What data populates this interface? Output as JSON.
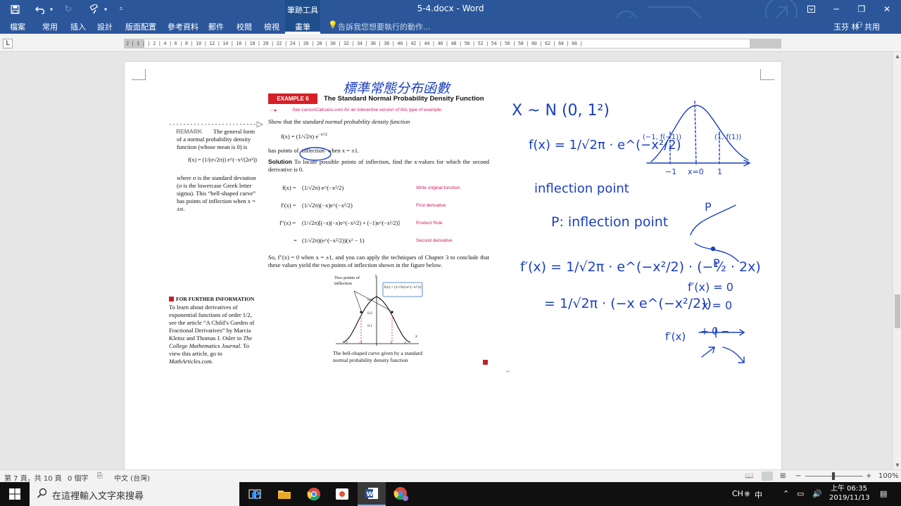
{
  "window": {
    "title": "5-4.docx - Word",
    "contextual_group": "筆跡工具",
    "minimize": "─",
    "restore": "❐",
    "close": "✕"
  },
  "ribbon": {
    "tabs": [
      "檔案",
      "常用",
      "插入",
      "設計",
      "版面配置",
      "參考資料",
      "郵件",
      "校閱",
      "檢視"
    ],
    "active_tab": "畫筆",
    "tell_me": "告訴我您想要執行的動作...",
    "user": "玉芬 林",
    "share": "共用"
  },
  "ruler": {
    "selector": "L",
    "ticks": "2 | 1 | | 2 | 4 | 6 | 8 | 10 | 12 | 14 | 16 | 18 | 20 | 22 | 24 | 26 | 28 | 30 | 32 | 34 | 36 | 38 | 40 | 42 | 44 | 46 | 48 | 50 | 52 | 54 | 56 | 58 | 60 | 62 | 64 | 66 |"
  },
  "textbook": {
    "example_badge": "EXAMPLE 6",
    "example_title": "The Standard Normal Probability Density Function",
    "example_link": "See LarsonCalculus.com for an interactive version of this type of example.",
    "show_that_1": "Show that the",
    "show_that_2": "standard normal probability density function",
    "fx_eq": "f(x) = (1/√2π) e",
    "fx_exp": "−x²/2",
    "has_points": "has points of",
    "inflection_word": "inflection",
    "when_x": "when x = ±1.",
    "solution_label": "Solution",
    "solution_text": "To locate possible points of inflection, find the x-values for which the second derivative is 0.",
    "deriv_lines": [
      {
        "lhs": "f(x) =",
        "rhs": "(1/√2π) e^(−x²/2)",
        "note": "Write original function."
      },
      {
        "lhs": "f′(x) =",
        "rhs": "(1/√2π)(−x)e^(−x²/2)",
        "note": "First derivative"
      },
      {
        "lhs": "f″(x) =",
        "rhs": "(1/√2π)[(−x)(−x)e^(−x²/2) + (−1)e^(−x²/2)]",
        "note": "Product Rule"
      },
      {
        "lhs": "=",
        "rhs": "(1/√2π)(e^(−x²/2))(x² − 1)",
        "note": "Second derivative"
      }
    ],
    "conclusion": "So, f″(x) = 0 when x = ±1, and you can apply the techniques of Chapter 3 to conclude that these values yield the two points of inflection shown in the figure below.",
    "remark_head": "REMARK",
    "remark_text_1": "The general form of a normal probability density function (whose mean is 0) is",
    "remark_formula": "f(x) = (1/(σ√2π)) e^(−x²/(2σ²))",
    "remark_text_2": "where σ is the standard deviation (σ is the lowercase Greek letter sigma). This “bell-shaped curve” has points of inflection when x = ±σ.",
    "ffi_head": "FOR FURTHER INFORMATION",
    "ffi_text_1": "To learn about derivatives of exponential functions of order 1/2, see the article “A Child’s Garden of Fractional Derivatives” by Marcia Kleinz and Thomas J. Osler in",
    "ffi_journal": "The College Mathematics Journal.",
    "ffi_text_2": "To view this article, go to",
    "ffi_site": "MathArticles.com.",
    "figure_label_points": "Two points of inflection",
    "figure_label_fx": "f(x) = (1/√2π) e^(−x²/2)",
    "figure_caption": "The bell-shaped curve given by a standard normal probability density function",
    "figure_yticks": [
      "0.3",
      "0.2",
      "0.1"
    ],
    "figure_xticks": [
      "−2",
      "−1",
      "1",
      "2"
    ],
    "figure_axis_x": "x",
    "figure_axis_y": "y",
    "para_mark": "↵"
  },
  "ink": {
    "heading": "標準常態分布函數",
    "line1": "X ~ N (0, 1²)",
    "line2": "f(x) = 1/√2π · e^(−x²/2)",
    "graph_left": "(−1, f(−1))",
    "graph_right": "(1, f(1))",
    "graph_ticks": [
      "−1",
      "x=0",
      "1"
    ],
    "inflection_point": "inflection point",
    "p_def": "P: inflection point",
    "p_label": "P",
    "deriv1": "f′(x) = 1/√2π · e^(−x²/2) · (−½ · 2x)",
    "deriv2": "= 1/√2π · (−x e^(−x²/2))",
    "f1_zero": "f′(x) = 0",
    "x_zero": "x = 0",
    "sign_label": "f′(x)",
    "sign_chart": "+  0  −"
  },
  "status": {
    "page": "第 7 頁，共 10 頁",
    "words": "0 個字",
    "language": "中文 (台灣)",
    "zoom": "100%"
  },
  "taskbar": {
    "search_placeholder": "在這裡輸入文字來搜尋",
    "ime": [
      "CH",
      "中"
    ],
    "time": "上午 06:35",
    "date": "2019/11/13"
  }
}
